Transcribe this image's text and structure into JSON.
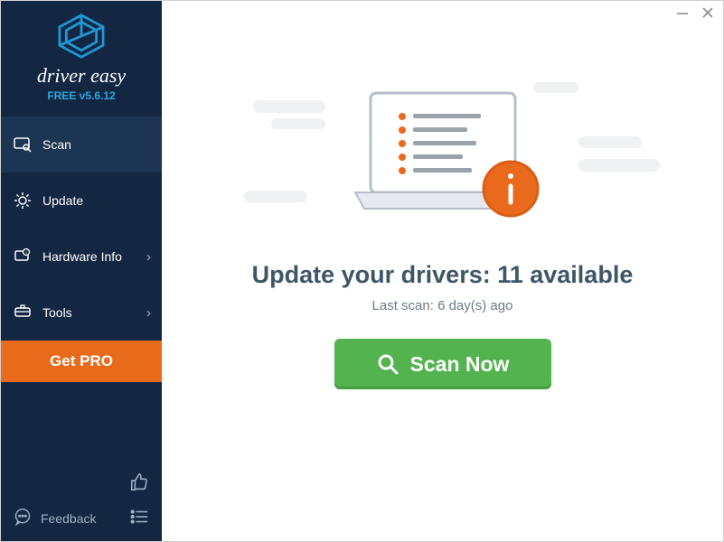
{
  "brand": {
    "name": "driver easy",
    "version": "FREE v5.6.12"
  },
  "sidebar": {
    "items": [
      {
        "label": "Scan"
      },
      {
        "label": "Update"
      },
      {
        "label": "Hardware Info"
      },
      {
        "label": "Tools"
      }
    ],
    "getpro": "Get PRO",
    "feedback": "Feedback"
  },
  "main": {
    "headline": "Update your drivers: 11 available",
    "subtext": "Last scan: 6 day(s) ago",
    "scan_label": "Scan Now"
  },
  "colors": {
    "sidebar_bg": "#132743",
    "accent_orange": "#e86b1c",
    "button_green": "#52b34f",
    "logo_blue": "#1f97d4"
  }
}
